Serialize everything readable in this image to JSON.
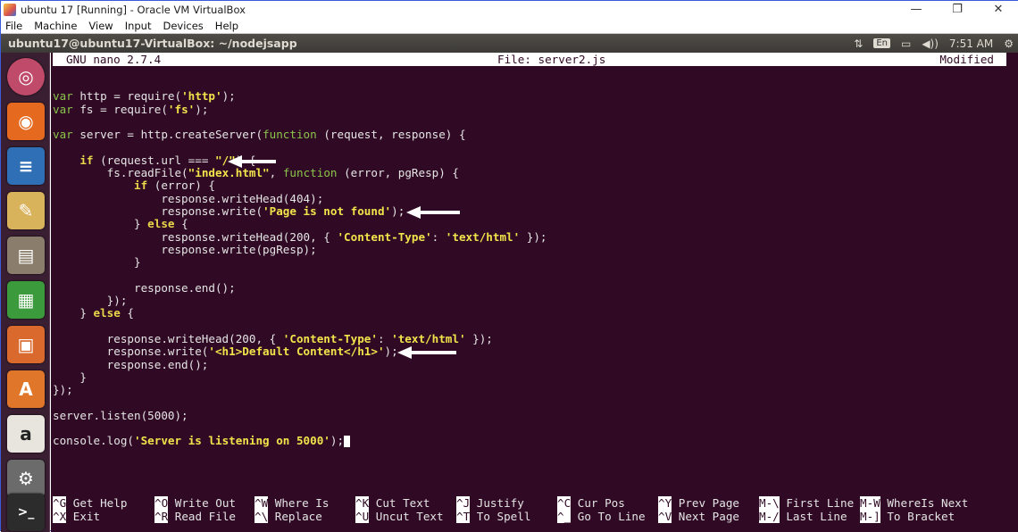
{
  "window": {
    "title": "ubuntu 17 [Running] - Oracle VM VirtualBox",
    "controls": [
      "—",
      "❐",
      "✕"
    ]
  },
  "menu": [
    "File",
    "Machine",
    "View",
    "Input",
    "Devices",
    "Help"
  ],
  "ubuntu_bar": {
    "title": "ubuntu17@ubuntu17-VirtualBox: ~/nodejsapp",
    "lang": "En",
    "time": "7:51 AM"
  },
  "nano": {
    "version": "GNU nano 2.7.4",
    "file": "File: server2.js",
    "status": "Modified"
  },
  "code_lines": [
    "",
    "var http = require('http');",
    "var fs = require('fs');",
    "",
    "var server = http.createServer(function (request, response) {",
    "",
    "    if (request.url === \"/\") {",
    "        fs.readFile(\"index.html\", function (error, pgResp) {",
    "            if (error) {",
    "                response.writeHead(404);",
    "                response.write('Page is not found');",
    "            } else {",
    "                response.writeHead(200, { 'Content-Type': 'text/html' });",
    "                response.write(pgResp);",
    "            }",
    "",
    "            response.end();",
    "        });",
    "    } else {",
    "",
    "        response.writeHead(200, { 'Content-Type': 'text/html' });",
    "        response.write('<h1>Default Content</h1>');",
    "        response.end();",
    "    }",
    "});",
    "",
    "server.listen(5000);",
    "",
    "console.log('Server is listening on 5000');"
  ],
  "shortcuts": [
    [
      {
        "key": "^G",
        "label": "Get Help"
      },
      {
        "key": "^X",
        "label": "Exit"
      }
    ],
    [
      {
        "key": "^O",
        "label": "Write Out"
      },
      {
        "key": "^R",
        "label": "Read File"
      }
    ],
    [
      {
        "key": "^W",
        "label": "Where Is"
      },
      {
        "key": "^\\",
        "label": "Replace"
      }
    ],
    [
      {
        "key": "^K",
        "label": "Cut Text"
      },
      {
        "key": "^U",
        "label": "Uncut Text"
      }
    ],
    [
      {
        "key": "^J",
        "label": "Justify"
      },
      {
        "key": "^T",
        "label": "To Spell"
      }
    ],
    [
      {
        "key": "^C",
        "label": "Cur Pos"
      },
      {
        "key": "^_",
        "label": "Go To Line"
      }
    ],
    [
      {
        "key": "^Y",
        "label": "Prev Page"
      },
      {
        "key": "^V",
        "label": "Next Page"
      }
    ],
    [
      {
        "key": "M-\\",
        "label": "First Line"
      },
      {
        "key": "M-/",
        "label": "Last Line"
      }
    ],
    [
      {
        "key": "M-W",
        "label": "WhereIs Next"
      },
      {
        "key": "M-]",
        "label": "To Bracket"
      }
    ]
  ],
  "launcher": [
    "ubuntu-dash",
    "firefox",
    "libreoffice-writer",
    "text-editor",
    "files",
    "libreoffice-calc",
    "libreoffice-impress",
    "software-center",
    "amazon",
    "system-settings",
    "terminal"
  ]
}
